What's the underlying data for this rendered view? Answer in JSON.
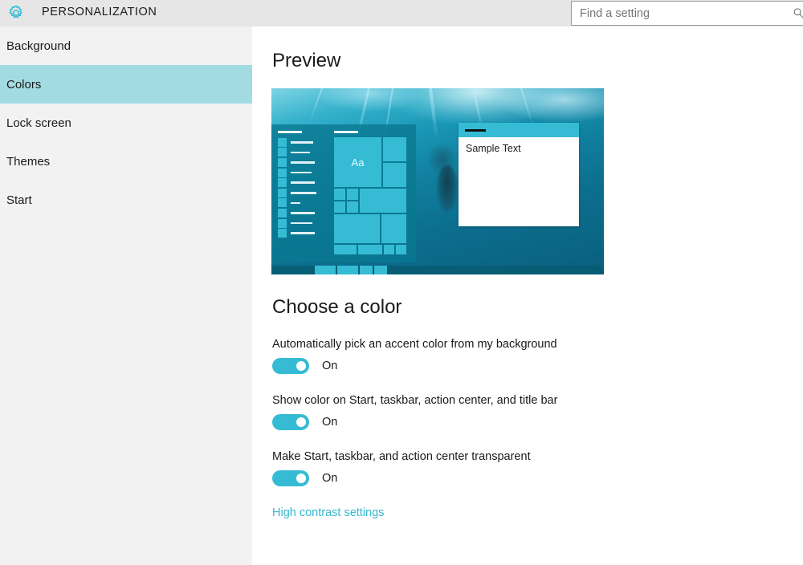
{
  "titlebar": {
    "app_title": "PERSONALIZATION",
    "gear_icon": "gear-icon",
    "accent_color": "#35bcd4"
  },
  "search": {
    "placeholder": "Find a setting",
    "value": "",
    "icon": "search-icon"
  },
  "sidebar": {
    "items": [
      {
        "label": "Background",
        "selected": false
      },
      {
        "label": "Colors",
        "selected": true
      },
      {
        "label": "Lock screen",
        "selected": false
      },
      {
        "label": "Themes",
        "selected": false
      },
      {
        "label": "Start",
        "selected": false
      }
    ],
    "background_color": "#f2f2f2",
    "selected_color": "#a3dbe3"
  },
  "main": {
    "preview_heading": "Preview",
    "choose_heading": "Choose a color",
    "preview": {
      "sample_window_text": "Sample Text",
      "tile_letter": "Aa",
      "wallpaper_description": "underwater ocean scene"
    },
    "settings": [
      {
        "label": "Automatically pick an accent color from my background",
        "state": "On",
        "checked": true
      },
      {
        "label": "Show color on Start, taskbar, action center, and title bar",
        "state": "On",
        "checked": true
      },
      {
        "label": "Make Start, taskbar, and action center transparent",
        "state": "On",
        "checked": true
      }
    ],
    "link": {
      "label": "High contrast settings",
      "color": "#37b8cf"
    }
  }
}
